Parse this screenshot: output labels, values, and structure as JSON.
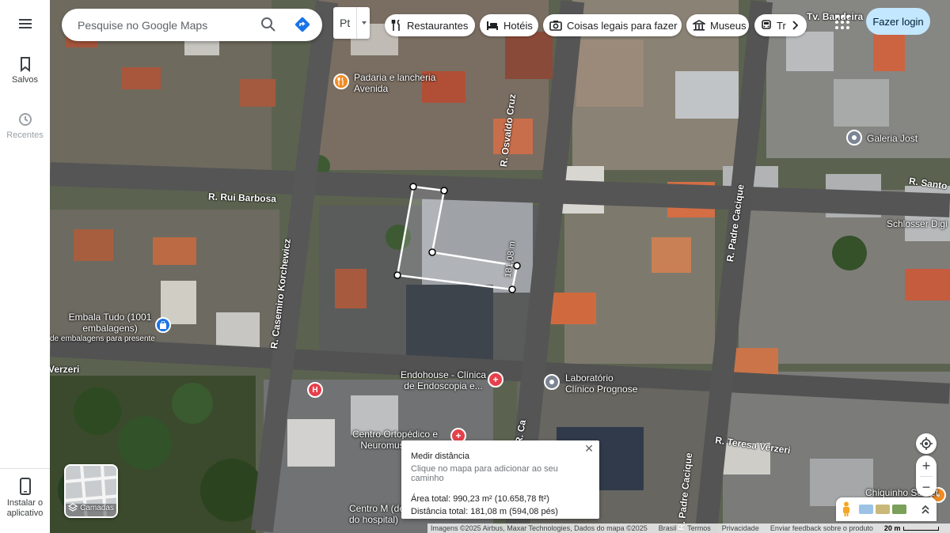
{
  "rail": {
    "menu_icon": "hamburger-icon",
    "saved_label": "Salvos",
    "recent_label": "Recentes",
    "install_label": "Instalar o aplicativo"
  },
  "search": {
    "placeholder": "Pesquise no Google Maps",
    "search_icon": "search-icon",
    "directions_icon": "directions-icon"
  },
  "language": {
    "code": "Pt"
  },
  "chips": [
    {
      "label": "Restaurantes",
      "icon": "fork-knife-icon"
    },
    {
      "label": "Hotéis",
      "icon": "bed-icon"
    },
    {
      "label": "Coisas legais para fazer",
      "icon": "camera-icon"
    },
    {
      "label": "Museus",
      "icon": "museum-icon"
    },
    {
      "label": "Tr",
      "icon": "transit-icon"
    }
  ],
  "header": {
    "login_label": "Fazer login"
  },
  "map": {
    "streets": [
      "Tv. Bandeira",
      "R. Rui Barbosa",
      "R. Osvaldo Cruz",
      "R. Casemiro Korchewicz",
      "R. Padre Cacique",
      "R. Padre Cacique",
      "R. Santo",
      "R. Teresa Verzeri",
      "Verzeri",
      "R. Ca"
    ],
    "places": {
      "padaria": "Padaria e lancheria Avenida",
      "galeria": "Galeria Jost",
      "schlosser": "Schlosser Digi",
      "embala": "Embala Tudo (1001 embalagens)",
      "embala_sub": "de embalagens para presente",
      "endohouse": "Endohouse - Clínica de Endoscopia e...",
      "laboratorio": "Laboratório Clínico Prognose",
      "ortopedico": "Centro Ortopédico e Neuromusculo...",
      "centro_m": "Centro M (dentro do hospital)",
      "chiquinho": "Chiquinho Sorvet"
    },
    "measure_label": "181,08 m"
  },
  "measure": {
    "title": "Medir distância",
    "subtitle": "Clique no mapa para adicionar ao seu caminho",
    "area": "Área total: 990,23 m² (10.658,78 ft²)",
    "distance": "Distância total: 181,08 m (594,08 pés)",
    "close_icon": "close-icon"
  },
  "layers": {
    "label": "Camadas"
  },
  "controls": {
    "zoom_in": "+",
    "zoom_out": "−"
  },
  "attribution": {
    "imagery": "Imagens ©2025 Airbus, Maxar Technologies, Dados do mapa ©2025",
    "country": "Brasil",
    "terms": "Termos",
    "privacy": "Privacidade",
    "feedback": "Enviar feedback sobre o produto",
    "scale": "20 m"
  },
  "colors": {
    "accent": "#1a73e8",
    "login_bg": "#c2e7ff",
    "measure_line": "#ffffff"
  }
}
